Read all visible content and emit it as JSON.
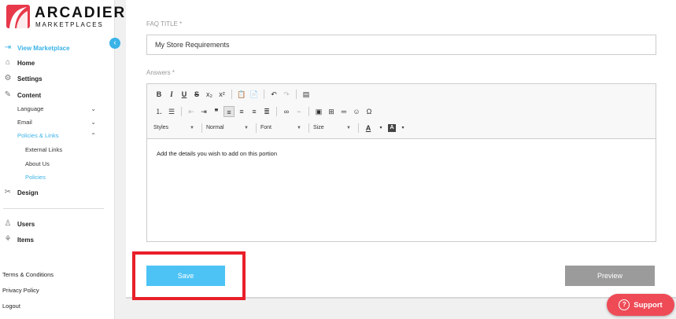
{
  "brand": {
    "name": "ARCADIER",
    "tagline": "MARKETPLACES",
    "accent": "#3ab3e8",
    "logo_color": "#e8394b"
  },
  "sidebar": {
    "view_marketplace": "View Marketplace",
    "home": "Home",
    "settings": "Settings",
    "content": "Content",
    "content_sub": [
      {
        "label": "Language",
        "chevron": "⌄"
      },
      {
        "label": "Email",
        "chevron": "⌄"
      },
      {
        "label": "Policies & Links",
        "chevron": "⌃"
      }
    ],
    "policies_sub": [
      "External Links",
      "About Us",
      "Policies"
    ],
    "design": "Design",
    "users": "Users",
    "items": "Items",
    "footer": [
      "Terms & Conditions",
      "Privacy Policy",
      "Logout"
    ]
  },
  "form": {
    "faq_title_label": "FAQ TITLE *",
    "faq_title_value": "My Store Requirements",
    "answers_label": "Answers *",
    "editor_content": "Add the details you wish to add on this portion",
    "toolbar": {
      "styles": "Styles",
      "format": "Normal",
      "font": "Font",
      "size": "Size"
    },
    "save_label": "Save",
    "preview_label": "Preview"
  },
  "support_label": "Support"
}
